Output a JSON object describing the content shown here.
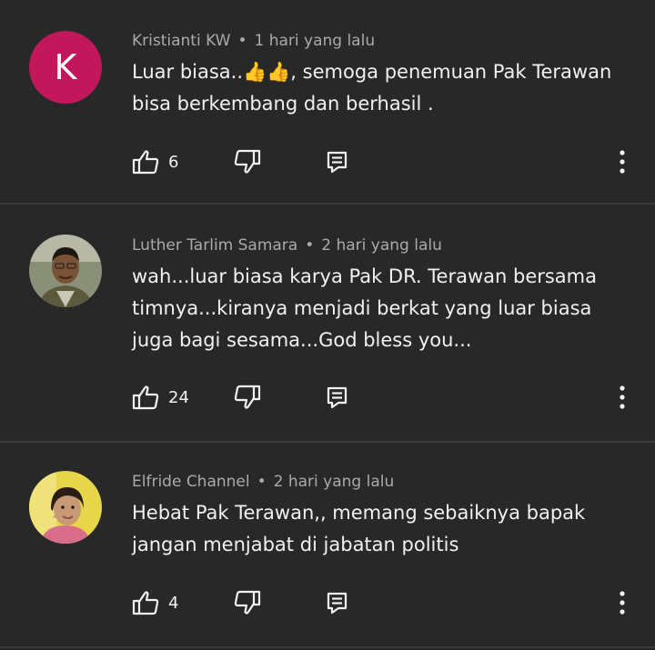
{
  "comments": [
    {
      "author": "Kristianti KW",
      "time": "1 hari yang lalu",
      "avatar_letter": "K",
      "text": "Luar biasa..👍👍, semoga penemuan Pak Terawan bisa berkembang dan berhasil .",
      "likes": "6"
    },
    {
      "author": "Luther Tarlim Samara",
      "time": "2 hari yang lalu",
      "text": "wah...luar biasa karya Pak DR. Terawan bersama timnya...kiranya menjadi berkat yang luar biasa juga bagi sesama...God bless you...",
      "likes": "24"
    },
    {
      "author": "Elfride Channel",
      "time": "2 hari yang lalu",
      "text": "Hebat Pak Terawan,, memang sebaiknya bapak jangan menjabat di jabatan politis",
      "likes": "4"
    }
  ],
  "separator": "•",
  "colors": {
    "background": "#282828",
    "avatar_k": "#c2185b",
    "meta": "#aaaaaa",
    "text": "#f1f1f1"
  }
}
